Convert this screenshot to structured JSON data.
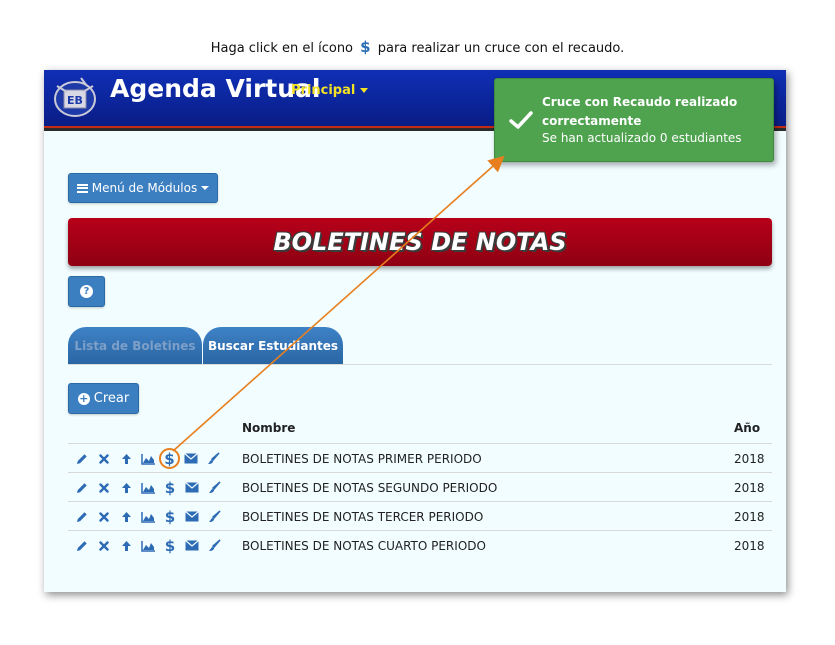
{
  "caption": {
    "before": "Haga click en el ícono",
    "symbol": "$",
    "after": "para realizar un cruce con el recaudo."
  },
  "header": {
    "app_title": "Agenda Virtual",
    "nav_principal": "Principal",
    "logo_icon": "institution-logo"
  },
  "toolbar": {
    "menu_label": "Menú de Módulos",
    "help_label": "?",
    "create_label": "Crear"
  },
  "banner": {
    "title": "BOLETINES DE NOTAS"
  },
  "tabs": [
    {
      "label": "Lista de Boletines",
      "active": false
    },
    {
      "label": "Buscar Estudiantes",
      "active": true
    }
  ],
  "table": {
    "headers": {
      "name": "Nombre",
      "year": "Año"
    },
    "action_icons": [
      "pencil-icon",
      "times-icon",
      "arrow-up-icon",
      "area-chart-icon",
      "dollar-icon",
      "envelope-icon",
      "brush-icon"
    ],
    "rows": [
      {
        "name": "BOLETINES DE NOTAS PRIMER PERIODO",
        "year": "2018"
      },
      {
        "name": "BOLETINES DE NOTAS SEGUNDO PERIODO",
        "year": "2018"
      },
      {
        "name": "BOLETINES DE NOTAS TERCER PERIODO",
        "year": "2018"
      },
      {
        "name": "BOLETINES DE NOTAS CUARTO PERIODO",
        "year": "2018"
      }
    ],
    "dollar_symbol": "$"
  },
  "toast": {
    "title": "Cruce con Recaudo realizado correctamente",
    "message": "Se han actualizado 0 estudiantes",
    "color": "#4fa34f"
  },
  "colors": {
    "primary_blue": "#3c7fc1",
    "header_blue": "#0f2fb5",
    "banner_red": "#b7001a",
    "highlight_orange": "#e87f1e",
    "nav_yellow": "#f3e224"
  }
}
